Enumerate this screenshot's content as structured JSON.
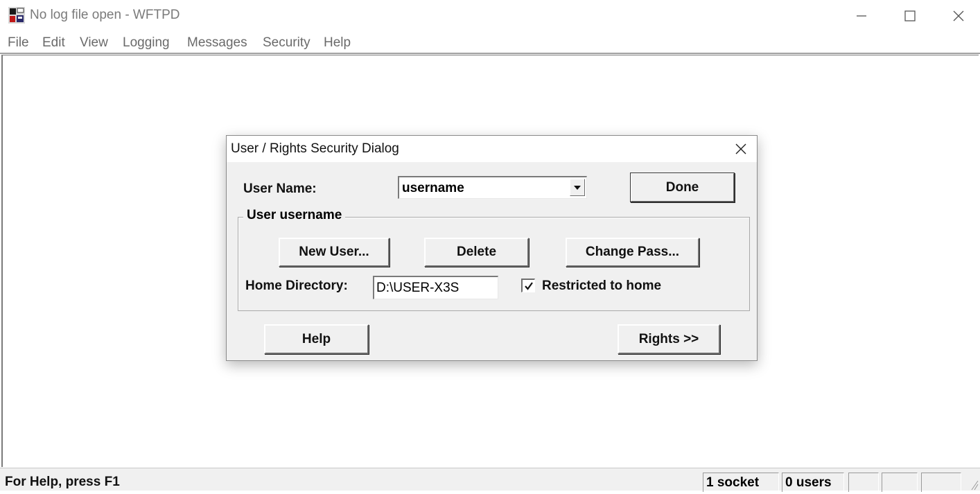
{
  "window": {
    "title": "No log file open - WFTPD",
    "icon": "wftpd-app-icon"
  },
  "menubar": {
    "items": [
      "File",
      "Edit",
      "View",
      "Logging",
      "Messages",
      "Security",
      "Help"
    ]
  },
  "statusbar": {
    "help_text": "For Help, press F1",
    "sockets": "1 socket",
    "users": "0 users"
  },
  "dialog": {
    "title": "User / Rights Security Dialog",
    "user_name_label": "User Name:",
    "user_name_value": "username",
    "done_label": "Done",
    "group_label": "User username",
    "new_user_label": "New User...",
    "delete_label": "Delete",
    "change_pass_label": "Change Pass...",
    "home_dir_label": "Home Directory:",
    "home_dir_value": "D:\\USER-X3S",
    "restricted_label": "Restricted to home",
    "restricted_checked": true,
    "help_label": "Help",
    "rights_label": "Rights >>"
  }
}
